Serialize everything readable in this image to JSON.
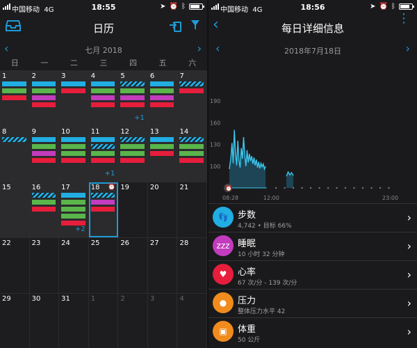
{
  "left": {
    "status": {
      "carrier": "中国移动",
      "network": "4G",
      "time": "18:55"
    },
    "title": "日历",
    "month": "七月 2018",
    "weekdays": [
      "日",
      "一",
      "二",
      "三",
      "四",
      "五",
      "六"
    ],
    "weeks": [
      [
        {
          "day": "1",
          "bars": [
            "blue",
            "green",
            "red"
          ]
        },
        {
          "day": "2",
          "bars": [
            "blue",
            "green",
            "pink",
            "red"
          ]
        },
        {
          "day": "3",
          "bars": [
            "blue",
            "red"
          ]
        },
        {
          "day": "4",
          "bars": [
            "blue",
            "green",
            "pink",
            "red"
          ]
        },
        {
          "day": "5",
          "bars": [
            "stripe",
            "green",
            "pink",
            "red"
          ],
          "plus": "+1"
        },
        {
          "day": "6",
          "bars": [
            "blue",
            "green",
            "pink",
            "red"
          ]
        },
        {
          "day": "7",
          "bars": [
            "stripe",
            "red"
          ]
        }
      ],
      [
        {
          "day": "8",
          "bars": [
            "stripe"
          ]
        },
        {
          "day": "9",
          "bars": [
            "blue",
            "green",
            "pink",
            "red"
          ]
        },
        {
          "day": "10",
          "bars": [
            "blue",
            "green",
            "green",
            "red"
          ]
        },
        {
          "day": "11",
          "bars": [
            "blue",
            "stripe",
            "green",
            "red"
          ],
          "plus": "+1"
        },
        {
          "day": "12",
          "bars": [
            "stripe",
            "green",
            "green",
            "red"
          ]
        },
        {
          "day": "13",
          "bars": [
            "blue",
            "green",
            "red"
          ]
        },
        {
          "day": "14",
          "bars": [
            "stripe",
            "green",
            "green",
            "red"
          ]
        }
      ],
      [
        {
          "day": "15",
          "bars": []
        },
        {
          "day": "16",
          "bars": [
            "stripe",
            "green",
            "red"
          ]
        },
        {
          "day": "17",
          "bars": [
            "blue",
            "green",
            "green",
            "green",
            "red"
          ],
          "plus": "+2"
        },
        {
          "day": "18",
          "bars": [
            "stripe",
            "pink",
            "red"
          ],
          "selected": true,
          "icon": "alarm"
        },
        {
          "day": "19",
          "bars": [],
          "empty": true
        },
        {
          "day": "20",
          "bars": [],
          "empty": true
        },
        {
          "day": "21",
          "bars": [],
          "empty": true
        }
      ],
      [
        {
          "day": "22",
          "bars": [],
          "empty": true
        },
        {
          "day": "23",
          "bars": [],
          "empty": true
        },
        {
          "day": "24",
          "bars": [],
          "empty": true
        },
        {
          "day": "25",
          "bars": [],
          "empty": true
        },
        {
          "day": "26",
          "bars": [],
          "empty": true
        },
        {
          "day": "27",
          "bars": [],
          "empty": true
        },
        {
          "day": "28",
          "bars": [],
          "empty": true
        }
      ],
      [
        {
          "day": "29",
          "bars": [],
          "empty": true
        },
        {
          "day": "30",
          "bars": [],
          "empty": true
        },
        {
          "day": "31",
          "bars": [],
          "empty": true
        },
        {
          "day": "1",
          "bars": [],
          "empty": true,
          "other": true
        },
        {
          "day": "2",
          "bars": [],
          "empty": true,
          "other": true
        },
        {
          "day": "3",
          "bars": [],
          "empty": true,
          "other": true
        },
        {
          "day": "4",
          "bars": [],
          "empty": true,
          "other": true
        }
      ]
    ],
    "colors": {
      "blue": "#21aee3",
      "green": "#5ab54b",
      "pink": "#c23cbd",
      "red": "#e61e3c"
    }
  },
  "right": {
    "status": {
      "carrier": "中国移动",
      "network": "4G",
      "time": "18:56"
    },
    "title": "每日详细信息",
    "date": "2018年7月18日",
    "chart_data": {
      "type": "area",
      "title": "",
      "yticks": [
        "190",
        "160",
        "130",
        "100"
      ],
      "ylim": [
        70,
        190
      ],
      "xticks": [
        "08:28",
        "12:00",
        "23:00"
      ],
      "x_range_hours": [
        8.47,
        23.0
      ],
      "series": [
        {
          "values_hr": [
            [
              8.47,
              96
            ],
            [
              8.6,
              112
            ],
            [
              8.7,
              132
            ],
            [
              8.8,
              104
            ],
            [
              8.9,
              150
            ],
            [
              9.0,
              118
            ],
            [
              9.1,
              101
            ],
            [
              9.2,
              135
            ],
            [
              9.3,
              108
            ],
            [
              9.4,
              98
            ],
            [
              9.5,
              125
            ],
            [
              9.6,
              110
            ],
            [
              9.7,
              140
            ],
            [
              9.8,
              115
            ],
            [
              9.9,
              100
            ],
            [
              10.0,
              122
            ],
            [
              10.1,
              105
            ],
            [
              10.2,
              117
            ],
            [
              10.3,
              107
            ],
            [
              10.4,
              114
            ],
            [
              10.5,
              103
            ],
            [
              10.6,
              112
            ],
            [
              10.7,
              101
            ],
            [
              10.8,
              109
            ],
            [
              10.9,
              98
            ],
            [
              11.0,
              106
            ],
            [
              11.1,
              97
            ],
            [
              11.2,
              104
            ],
            [
              11.3,
              99
            ],
            [
              11.4,
              103
            ],
            [
              11.5,
              96
            ],
            [
              11.6,
              100
            ]
          ]
        },
        {
          "values_hr": [
            [
              13.4,
              86
            ],
            [
              13.55,
              92
            ],
            [
              13.7,
              88
            ],
            [
              13.85,
              91
            ],
            [
              14.0,
              87
            ]
          ]
        }
      ],
      "colors": {
        "line": "#3cc8f0",
        "fill": "#1f4a5c"
      }
    },
    "metrics": [
      {
        "name": "步数",
        "sub": "4,742 • 目标 66%",
        "color": "#21aee3",
        "icon_name": "footprint-icon",
        "glyph": "👣"
      },
      {
        "name": "睡眠",
        "sub": "10 小时 32 分钟",
        "color": "#c23cbd",
        "icon_name": "sleep-icon",
        "glyph": "zzz"
      },
      {
        "name": "心率",
        "sub": "67 次/分 - 139 次/分",
        "color": "#e61e3c",
        "icon_name": "heart-icon",
        "glyph": "♥"
      },
      {
        "name": "压力",
        "sub": "整体压力水平 42",
        "color": "#f08c1e",
        "icon_name": "stress-icon",
        "glyph": "●"
      },
      {
        "name": "体重",
        "sub": "50 公斤",
        "color": "#f08c1e",
        "icon_name": "scale-icon",
        "glyph": "▣"
      }
    ]
  }
}
